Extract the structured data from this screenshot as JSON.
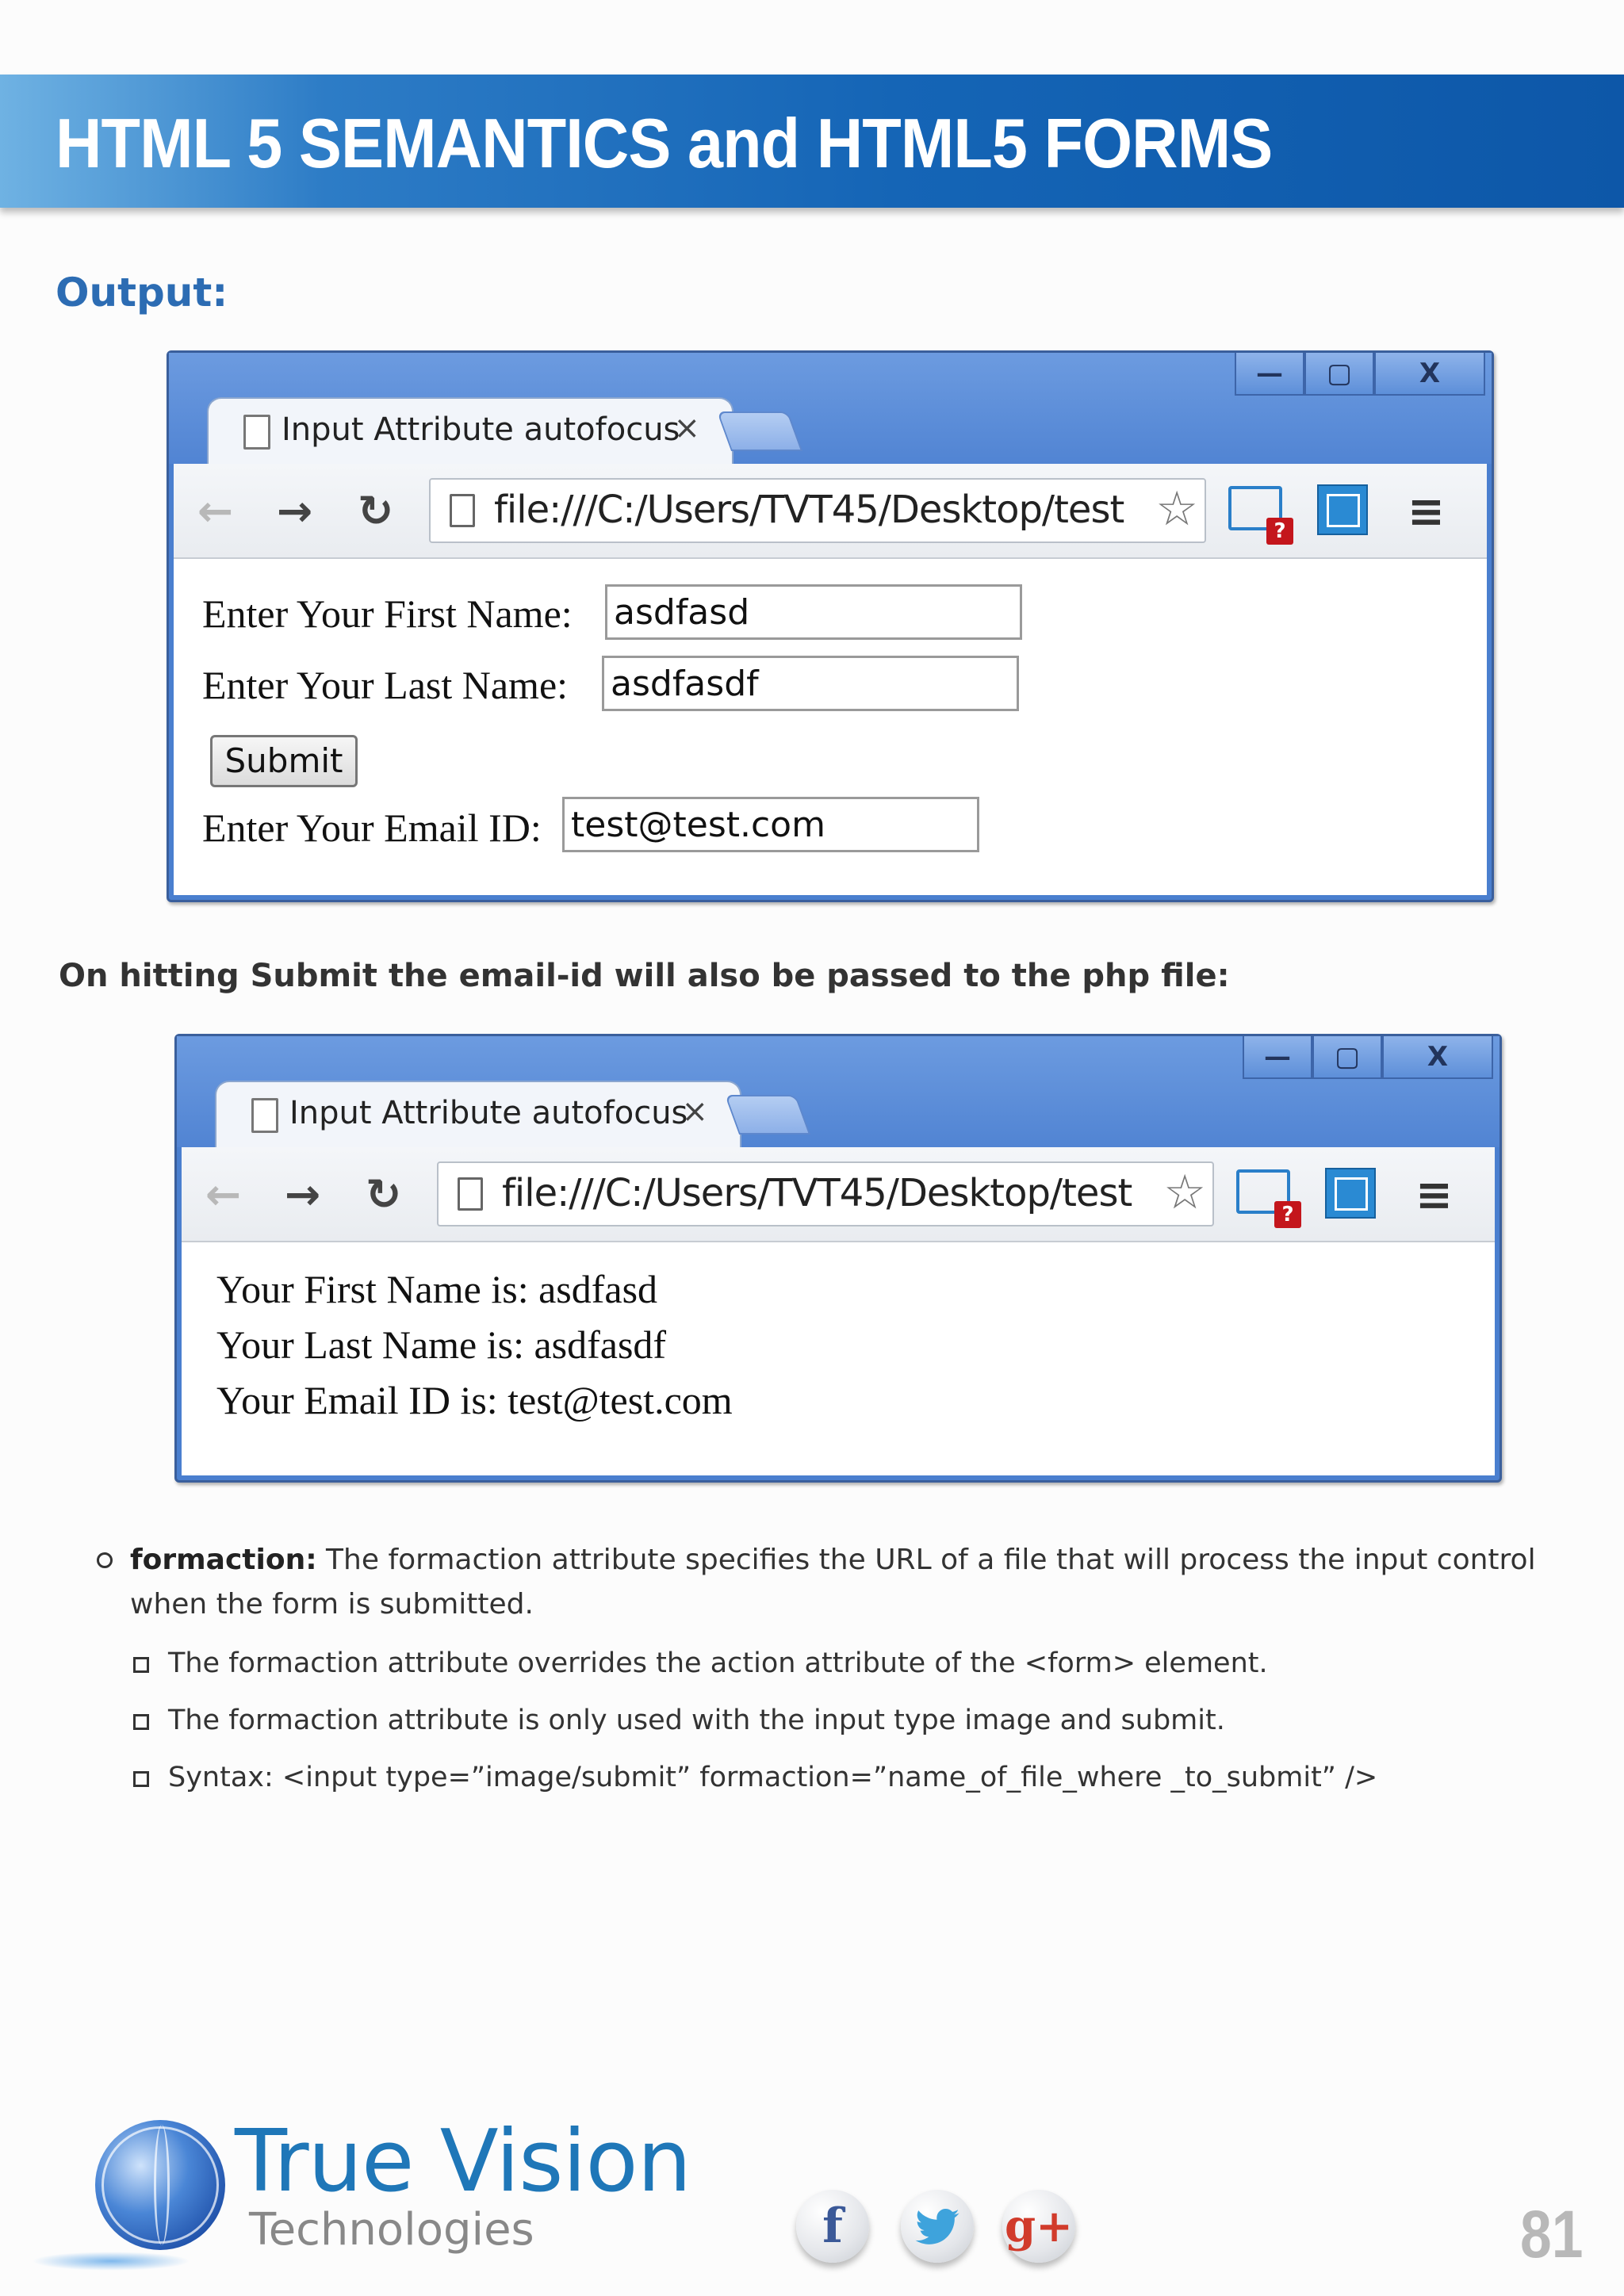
{
  "header": {
    "title": "HTML 5 SEMANTICS and HTML5 FORMS"
  },
  "section_title": "Output:",
  "browser1": {
    "window_controls": {
      "minimize": "—",
      "maximize": "▢",
      "close": "X"
    },
    "tab_title": "Input Attribute autofocus",
    "tab_close": "×",
    "url": "file:///C:/Users/TVT45/Desktop/test",
    "form": {
      "first_name_label": "Enter Your First Name:",
      "first_name_value": "asdfasd",
      "last_name_label": "Enter Your Last Name:",
      "last_name_value": "asdfasdf",
      "submit_label": "Submit",
      "email_label": "Enter Your Email ID:",
      "email_value": "test@test.com"
    }
  },
  "caption": "On hitting Submit the email-id will also be passed to the php file:",
  "browser2": {
    "window_controls": {
      "minimize": "—",
      "maximize": "▢",
      "close": "X"
    },
    "tab_title": "Input Attribute autofocus",
    "tab_close": "×",
    "url": "file:///C:/Users/TVT45/Desktop/test",
    "result": {
      "line1": "Your First Name is: asdfasd",
      "line2": "Your Last Name is: asdfasdf",
      "line3": "Your Email ID is: test@test.com"
    }
  },
  "bullets": {
    "main_term": "formaction:",
    "main_text": " The formaction attribute specifies the URL of a file that will process the input control when the form is submitted.",
    "sub": [
      "The formaction attribute overrides the action attribute of the <form> element.",
      "The formaction attribute is only used with the input type image and submit.",
      "Syntax: <input type=”image/submit” formaction=”name_of_file_where _to_submit” />"
    ]
  },
  "footer": {
    "brand_name": "True Vision",
    "brand_sub": "Technologies",
    "social": {
      "facebook": "f",
      "twitter": "🐦",
      "googleplus": "g+"
    },
    "page_number": "81"
  },
  "colors": {
    "banner": "#1565b6",
    "heading": "#2c6cb3",
    "brand": "#1f77b8"
  }
}
